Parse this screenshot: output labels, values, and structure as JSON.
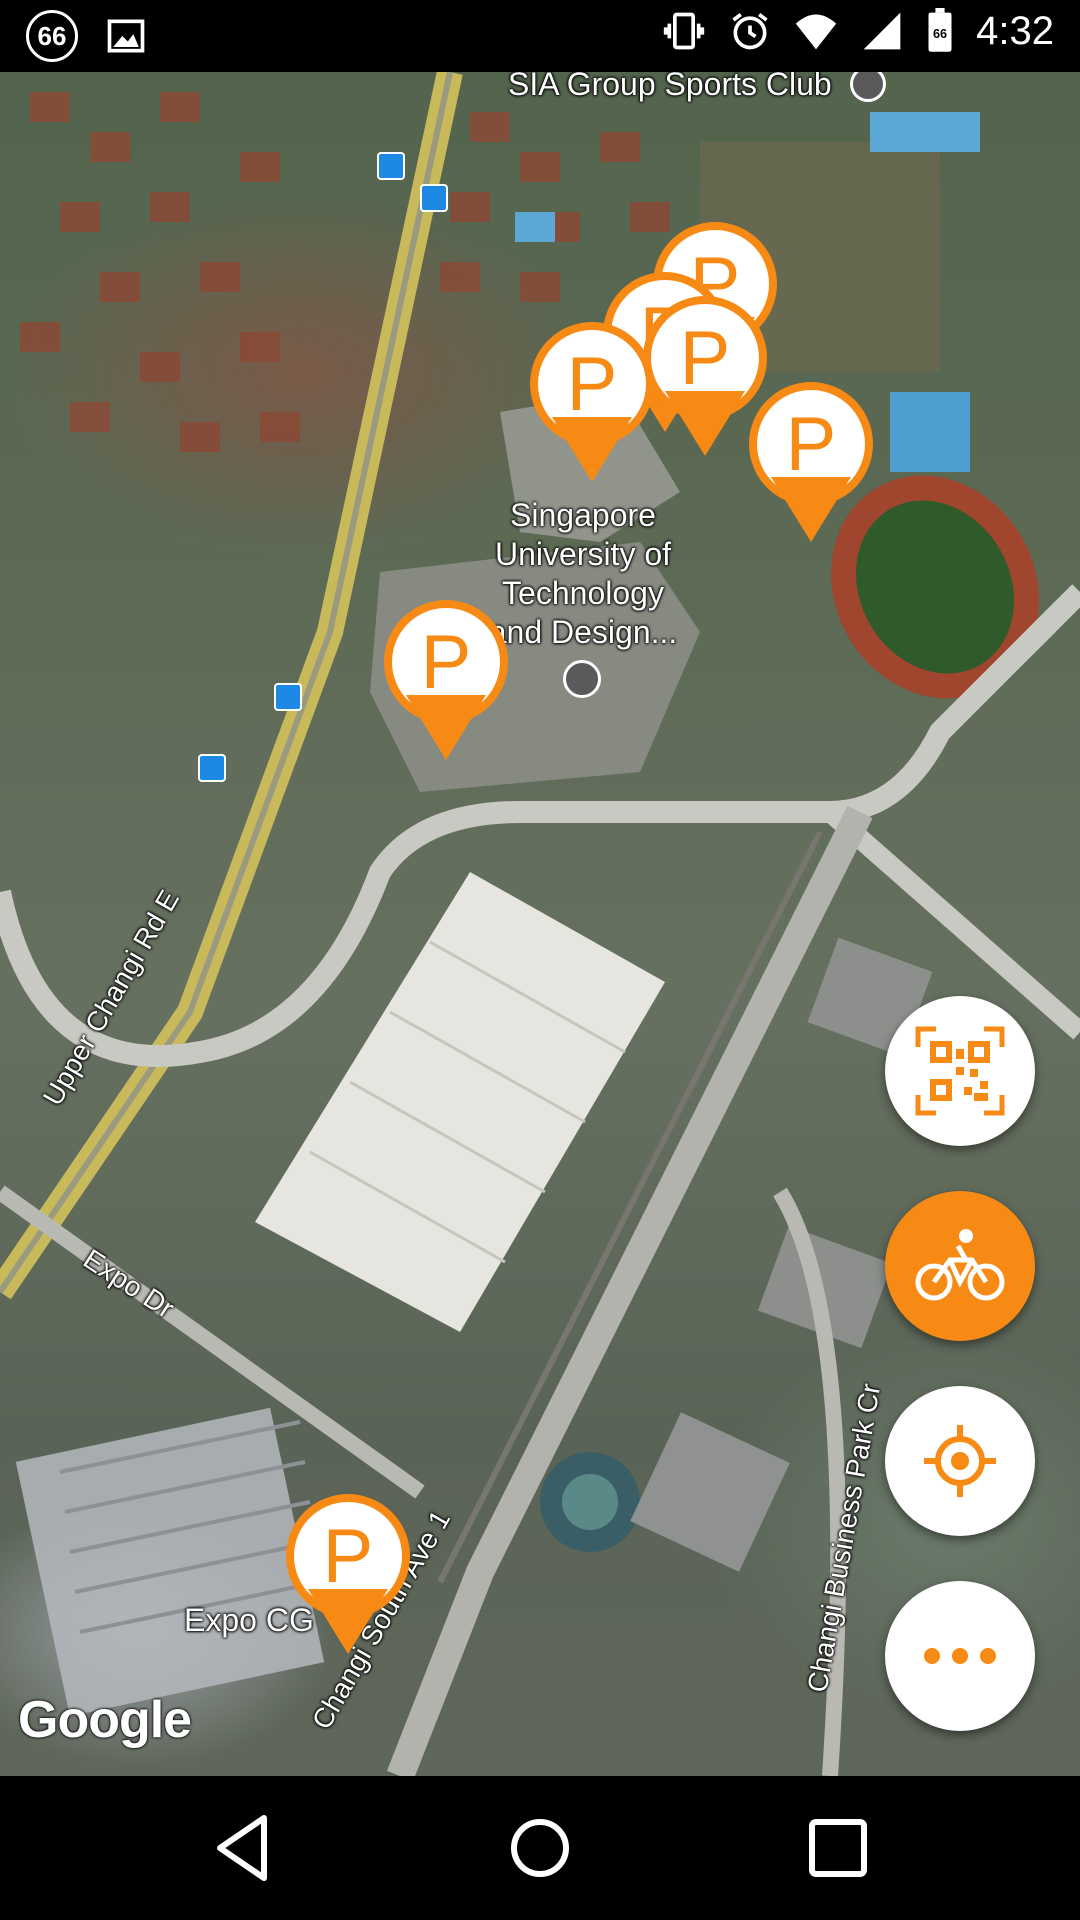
{
  "status_bar": {
    "notification_badge": "66",
    "battery_level": "66",
    "time": "4:32",
    "icons": [
      "notification-66-icon",
      "image-icon",
      "vibrate-icon",
      "alarm-icon",
      "wifi-icon",
      "signal-icon",
      "battery-icon"
    ]
  },
  "map": {
    "labels": {
      "sports_club": "SIA Group Sports Club",
      "university_line1": "Singapore",
      "university_line2": "University of",
      "university_line3": "Technology",
      "university_line4": "and Design...",
      "upper_changi": "Upper Changi Rd E",
      "expo_dr": "Expo Dr",
      "expo_cg": "Expo CG",
      "changi_south": "Changi South Ave 1",
      "changi_business": "Changi Business Park Cr"
    },
    "parking_marker_letter": "P",
    "parking_marker_count": 8,
    "attribution": "Google"
  },
  "fabs": [
    {
      "name": "qr-scan",
      "icon": "qr-code-icon"
    },
    {
      "name": "bicycle",
      "icon": "bicycle-icon"
    },
    {
      "name": "my-location",
      "icon": "location-target-icon"
    },
    {
      "name": "more",
      "icon": "more-horizontal-icon"
    }
  ],
  "colors": {
    "accent": "#f78a14",
    "fab_background": "#ffffff"
  },
  "nav_bar": {
    "buttons": [
      "back-icon",
      "home-icon",
      "recents-icon"
    ]
  }
}
